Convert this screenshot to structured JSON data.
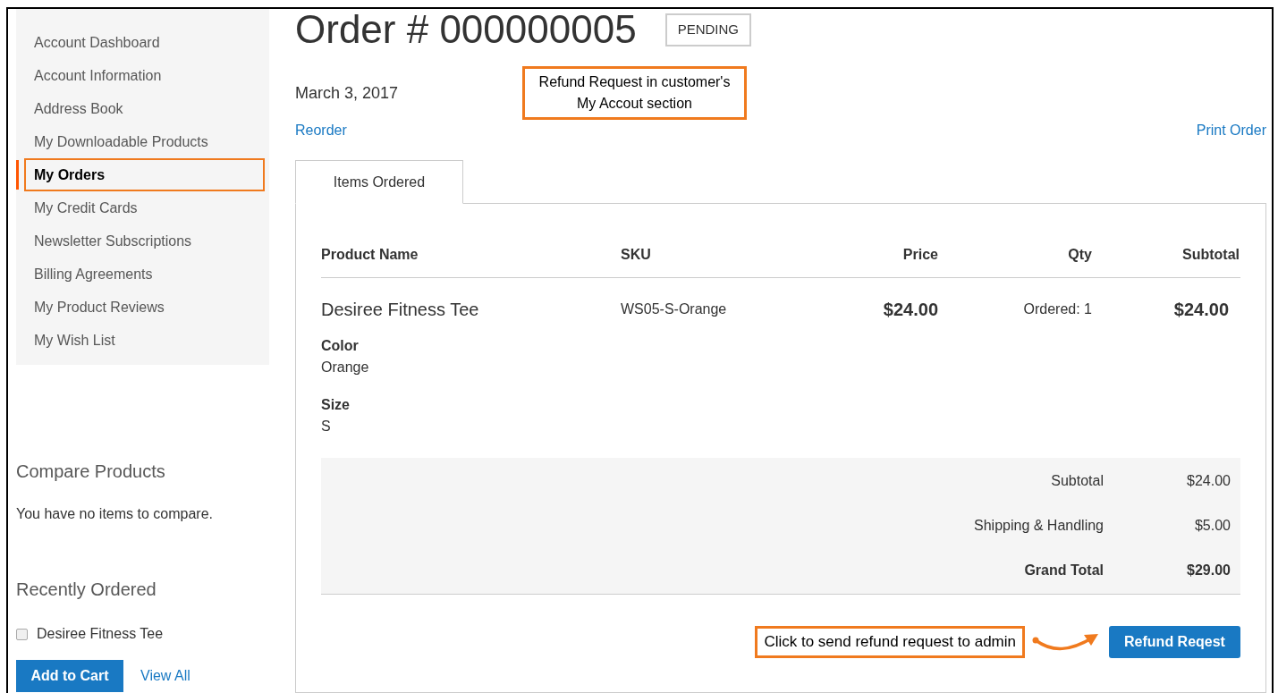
{
  "sidebar": {
    "nav": [
      {
        "label": "Account Dashboard",
        "selected": false
      },
      {
        "label": "Account Information",
        "selected": false
      },
      {
        "label": "Address Book",
        "selected": false
      },
      {
        "label": "My Downloadable Products",
        "selected": false
      },
      {
        "label": "My Orders",
        "selected": true
      },
      {
        "label": "My Credit Cards",
        "selected": false
      },
      {
        "label": "Newsletter Subscriptions",
        "selected": false
      },
      {
        "label": "Billing Agreements",
        "selected": false
      },
      {
        "label": "My Product Reviews",
        "selected": false
      },
      {
        "label": "My Wish List",
        "selected": false
      }
    ],
    "compare": {
      "title": "Compare Products",
      "message": "You have no items to compare."
    },
    "recently_ordered": {
      "title": "Recently Ordered",
      "items": [
        {
          "label": "Desiree Fitness Tee",
          "checked": false
        }
      ],
      "add_button": "Add to Cart",
      "view_all": "View All"
    }
  },
  "order": {
    "title": "Order # 000000005",
    "status": "PENDING",
    "date": "March 3, 2017",
    "callout": [
      "Refund Request in customer's",
      "My Accout section"
    ],
    "reorder": "Reorder",
    "print": "Print Order",
    "tabs": [
      {
        "label": "Items Ordered",
        "selected": true
      }
    ],
    "table": {
      "columns": [
        "Product Name",
        "SKU",
        "Price",
        "Qty",
        "Subtotal"
      ],
      "rows": [
        {
          "name": "Desiree Fitness Tee",
          "sku": "WS05-S-Orange",
          "price": "$24.00",
          "qty": "Ordered: 1",
          "subtotal": "$24.00",
          "options": [
            {
              "label": "Color",
              "value": "Orange"
            },
            {
              "label": "Size",
              "value": "S"
            }
          ]
        }
      ]
    },
    "totals": [
      {
        "kind": "line",
        "label": "Subtotal",
        "value": "$24.00"
      },
      {
        "kind": "line",
        "label": "Shipping & Handling",
        "value": "$5.00"
      },
      {
        "kind": "grand",
        "label": "Grand Total",
        "value": "$29.00"
      }
    ],
    "refund_callout": "Click to send refund request to admin",
    "refund_button": "Refund Reqest"
  }
}
